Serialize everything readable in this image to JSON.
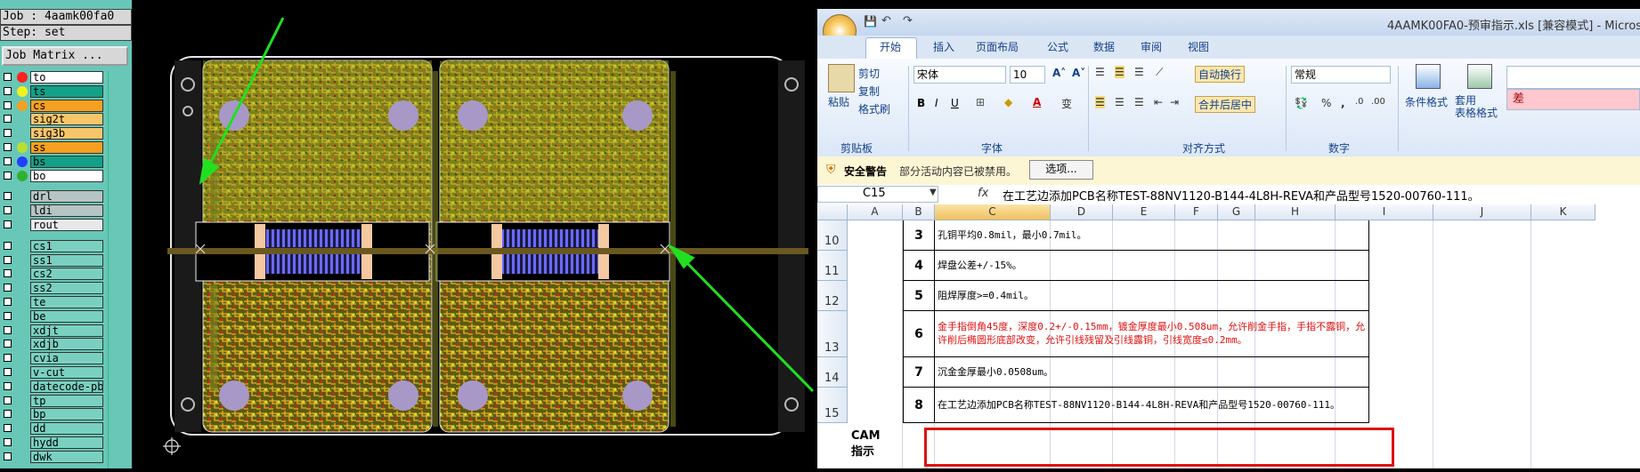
{
  "cam": {
    "job_line": "Job : 4aamk00fa0",
    "step_line": "Step: set",
    "job_matrix_label": "Job Matrix ...",
    "layers": [
      {
        "name": "to",
        "dot": "#ff2020",
        "bg": "#ffffff"
      },
      {
        "name": "ts",
        "dot": "#f2f21a",
        "bg": "#14a087"
      },
      {
        "name": "cs",
        "dot": "#f5a020",
        "bg": "#f5a020"
      },
      {
        "name": "sig2t",
        "dot": "",
        "bg": "#f7c56a"
      },
      {
        "name": "sig3b",
        "dot": "",
        "bg": "#f7c56a"
      },
      {
        "name": "ss",
        "dot": "#b8e030",
        "bg": "#f5a020"
      },
      {
        "name": "bs",
        "dot": "#2040ff",
        "bg": "#14a087"
      },
      {
        "name": "bo",
        "dot": "#30b030",
        "bg": "#ffffff"
      },
      {
        "name": "drl",
        "dot": "",
        "bg": "#b7c4c4"
      },
      {
        "name": "ldi",
        "dot": "",
        "bg": "#b7c4c4"
      },
      {
        "name": "rout",
        "dot": "",
        "bg": "#e8e8e8"
      },
      {
        "name": "cs1",
        "dot": "",
        "bg": "#7ad0c0"
      },
      {
        "name": "ss1",
        "dot": "",
        "bg": "#7ad0c0"
      },
      {
        "name": "cs2",
        "dot": "",
        "bg": "#7ad0c0"
      },
      {
        "name": "ss2",
        "dot": "",
        "bg": "#7ad0c0"
      },
      {
        "name": "te",
        "dot": "",
        "bg": "#7ad0c0"
      },
      {
        "name": "be",
        "dot": "",
        "bg": "#7ad0c0"
      },
      {
        "name": "xdjt",
        "dot": "",
        "bg": "#7ad0c0"
      },
      {
        "name": "xdjb",
        "dot": "",
        "bg": "#7ad0c0"
      },
      {
        "name": "cvia",
        "dot": "",
        "bg": "#7ad0c0"
      },
      {
        "name": "v-cut",
        "dot": "",
        "bg": "#7ad0c0"
      },
      {
        "name": "datecode-pbe",
        "dot": "",
        "bg": "#7ad0c0"
      },
      {
        "name": "tp",
        "dot": "",
        "bg": "#7ad0c0"
      },
      {
        "name": "bp",
        "dot": "",
        "bg": "#7ad0c0"
      },
      {
        "name": "dd",
        "dot": "",
        "bg": "#7ad0c0"
      },
      {
        "name": "hydd",
        "dot": "",
        "bg": "#7ad0c0"
      },
      {
        "name": "dwk",
        "dot": "",
        "bg": "#7ad0c0"
      }
    ]
  },
  "excel": {
    "title": "4AAMK00FA0-预审指示.xls [兼容模式] - Microso",
    "tabs": [
      "开始",
      "插入",
      "页面布局",
      "公式",
      "数据",
      "审阅",
      "视图"
    ],
    "ribbon": {
      "clipboard": {
        "paste": "粘贴",
        "cut": "剪切",
        "copy": "复制",
        "format_painter": "格式刷",
        "label": "剪贴板"
      },
      "font": {
        "name": "宋体",
        "size": "10",
        "label": "字体"
      },
      "align": {
        "wrap": "自动换行",
        "merge": "合并后居中",
        "label": "对齐方式"
      },
      "number": {
        "format": "常规",
        "label": "数字"
      },
      "styles": {
        "conditional": "条件格式",
        "table": "套用\n表格格式",
        "bad": "差"
      }
    },
    "security": {
      "title": "安全警告",
      "message": "部分活动内容已被禁用。",
      "options": "选项..."
    },
    "formula_bar": {
      "cell_ref": "C15",
      "fx": "fx",
      "content": "在工艺边添加PCB名称TEST-88NV1120-B144-4L8H-REVA和产品型号1520-00760-111。"
    },
    "columns": [
      "A",
      "B",
      "C",
      "D",
      "E",
      "F",
      "G",
      "H",
      "I",
      "J",
      "K"
    ],
    "rows": [
      {
        "row": "10",
        "num": "3",
        "text": "孔铜平均0.8mil，最小0.7mil。",
        "red": false
      },
      {
        "row": "11",
        "num": "4",
        "text": "焊盘公差+/-15%。",
        "red": false
      },
      {
        "row": "12",
        "num": "5",
        "text": "阻焊厚度>=0.4mil。",
        "red": false
      },
      {
        "row": "13",
        "num": "6",
        "text": "金手指倒角45度，深度0.2+/-0.15mm，镀金厚度最小0.508um，允许削金手指，手指不露铜，允许削后椭圆形底部改变，允许引线残留及引线露铜，引线宽度≤0.2mm。",
        "red": true
      },
      {
        "row": "14",
        "num": "7",
        "text": "沉金金厚最小0.0508um。",
        "red": false
      },
      {
        "row": "15",
        "num": "8",
        "text": "在工艺边添加PCB名称TEST-88NV1120-B144-4L8H-REVA和产品型号1520-00760-111。",
        "red": false
      }
    ],
    "a_col_label": "CAM\n指示"
  }
}
